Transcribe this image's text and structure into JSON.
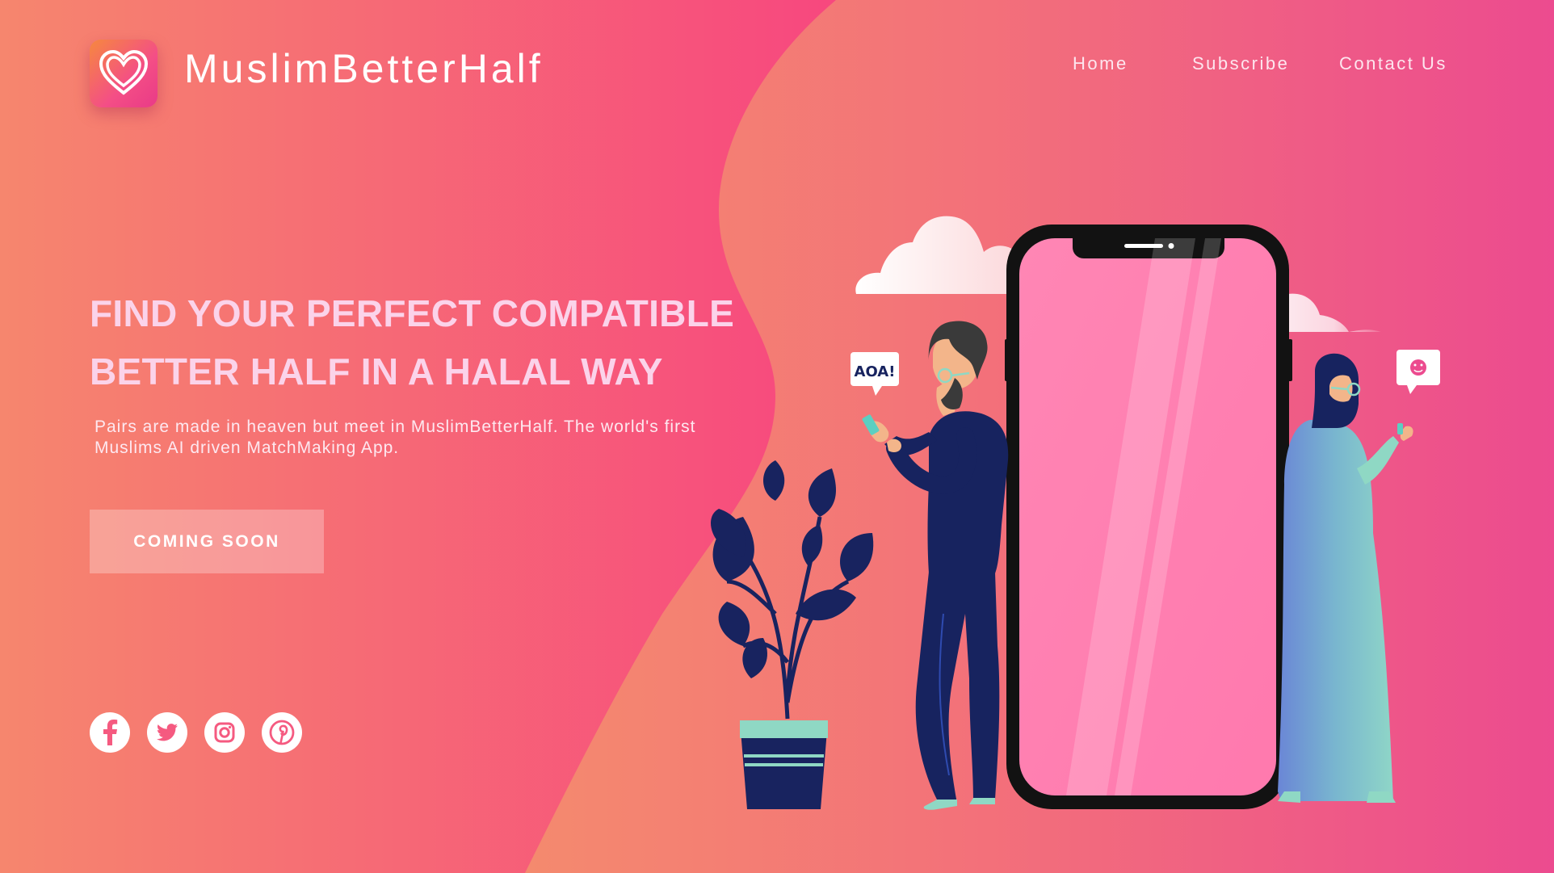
{
  "brand": {
    "name": "MuslimBetterHalf",
    "logo_icon": "heart-icon"
  },
  "nav": {
    "home": "Home",
    "subscribe": "Subscribe",
    "contact": "Contact Us"
  },
  "hero": {
    "headline_line1": "FIND YOUR PERFECT COMPATIBLE",
    "headline_line2": "BETTER HALF IN A HALAL WAY",
    "tagline": "Pairs are made in heaven but meet in MuslimBetterHalf. The world's first Muslims AI driven MatchMaking App.",
    "cta_label": "COMING SOON"
  },
  "illustration": {
    "speech_bubble_man": "AOA!",
    "speech_bubble_woman_icon": "smiley-icon"
  },
  "social": {
    "icons": [
      "facebook-icon",
      "twitter-icon",
      "instagram-icon",
      "pinterest-icon"
    ]
  },
  "colors": {
    "pink": "#f7417f",
    "coral": "#f48a6e",
    "magenta": "#ec4b8f",
    "navy": "#17235f"
  }
}
